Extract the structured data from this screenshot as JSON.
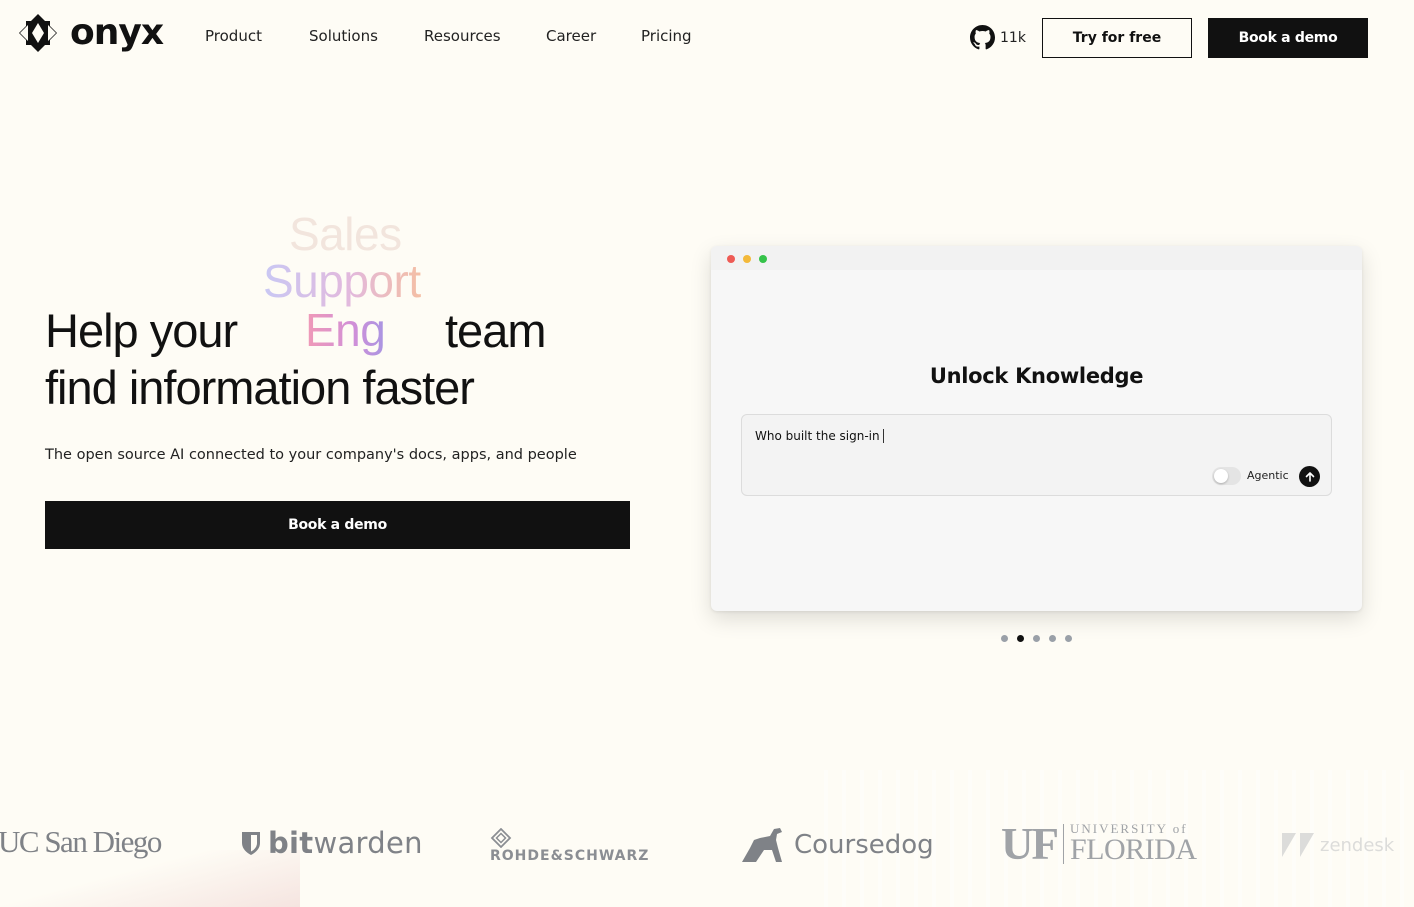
{
  "header": {
    "brand": "onyx",
    "nav": [
      "Product",
      "Solutions",
      "Resources",
      "Career",
      "Pricing"
    ],
    "github_count": "11k",
    "try_label": "Try for free",
    "demo_label": "Book a demo"
  },
  "hero": {
    "rolling_words": [
      "Sales",
      "Support",
      "Eng"
    ],
    "line1_prefix": "Help your",
    "line1_suffix": "team",
    "line2": "find information faster",
    "subtitle": "The open source AI connected to your company's docs, apps, and people",
    "cta_label": "Book a demo"
  },
  "demo_window": {
    "title": "Unlock Knowledge",
    "query": "Who built the sign-in",
    "toggle_label": "Agentic",
    "toggle_on": false,
    "pager_count": 5,
    "pager_active_index": 1
  },
  "logos": {
    "ucsd": "UC San Diego",
    "bitwarden_bold": "bit",
    "bitwarden_rest": "warden",
    "rohde": "ROHDE&SCHWARZ",
    "coursedog": "Coursedog",
    "uf_big": "UF",
    "uf_line1": "UNIVERSITY of",
    "uf_line2": "FLORIDA",
    "zendesk": "zendesk"
  },
  "colors": {
    "background": "#fefcf5",
    "primary_button": "#111111",
    "text": "#111111"
  }
}
